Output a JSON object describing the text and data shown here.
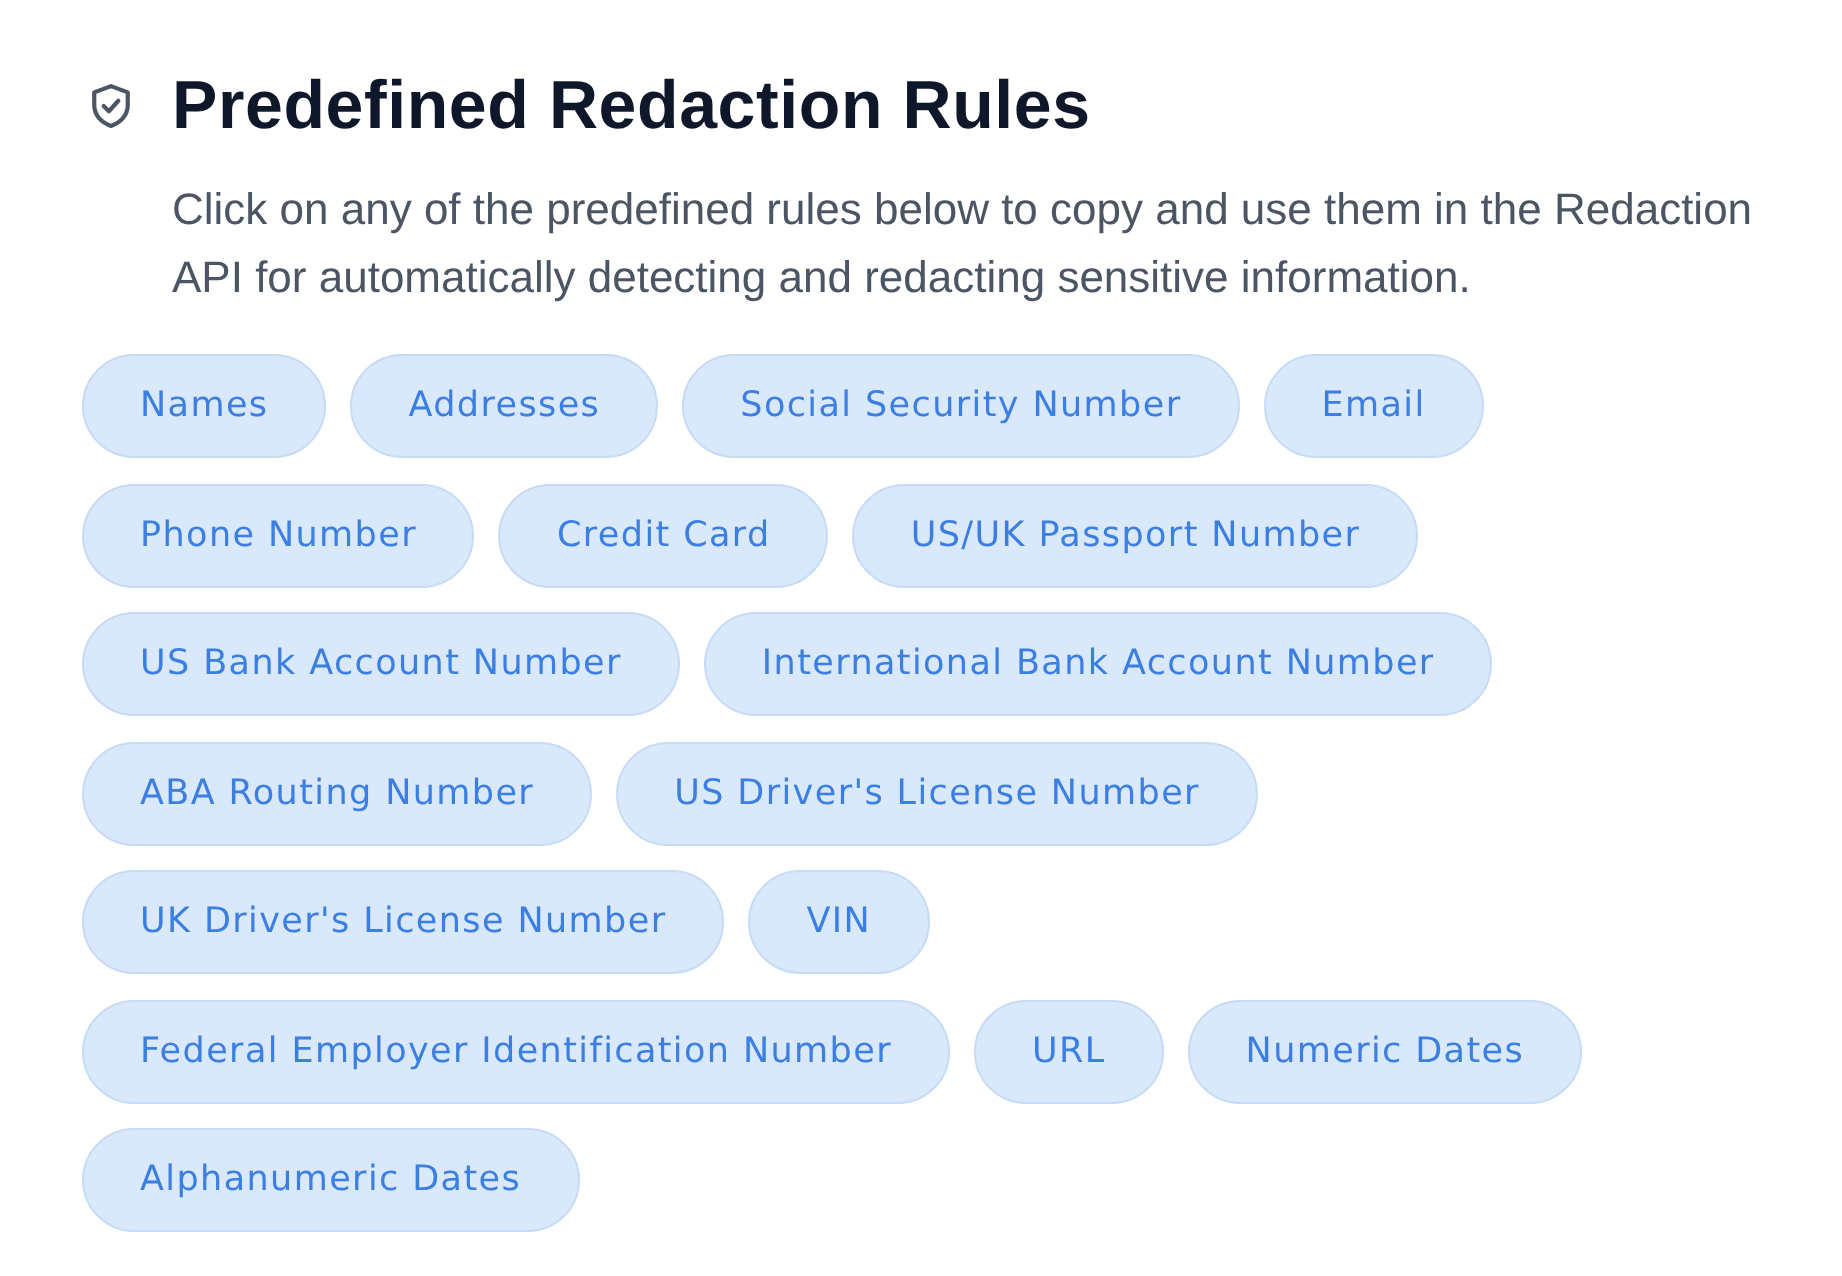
{
  "header": {
    "title": "Predefined Redaction Rules",
    "description": "Click on any of the predefined rules below to copy and use them in the Redaction API for automatically detecting and redacting sensitive information."
  },
  "rules": [
    {
      "label": "Names"
    },
    {
      "label": "Addresses"
    },
    {
      "label": "Social Security Number"
    },
    {
      "label": "Email"
    },
    {
      "label": "Phone Number"
    },
    {
      "label": "Credit Card"
    },
    {
      "label": "US/UK Passport Number"
    },
    {
      "label": "US Bank Account Number"
    },
    {
      "label": "International Bank Account Number"
    },
    {
      "label": "ABA Routing Number"
    },
    {
      "label": "US Driver's License Number"
    },
    {
      "label": "UK Driver's License Number"
    },
    {
      "label": "VIN"
    },
    {
      "label": "Federal Employer Identification Number"
    },
    {
      "label": "URL"
    },
    {
      "label": "Numeric Dates"
    },
    {
      "label": "Alphanumeric Dates"
    }
  ]
}
